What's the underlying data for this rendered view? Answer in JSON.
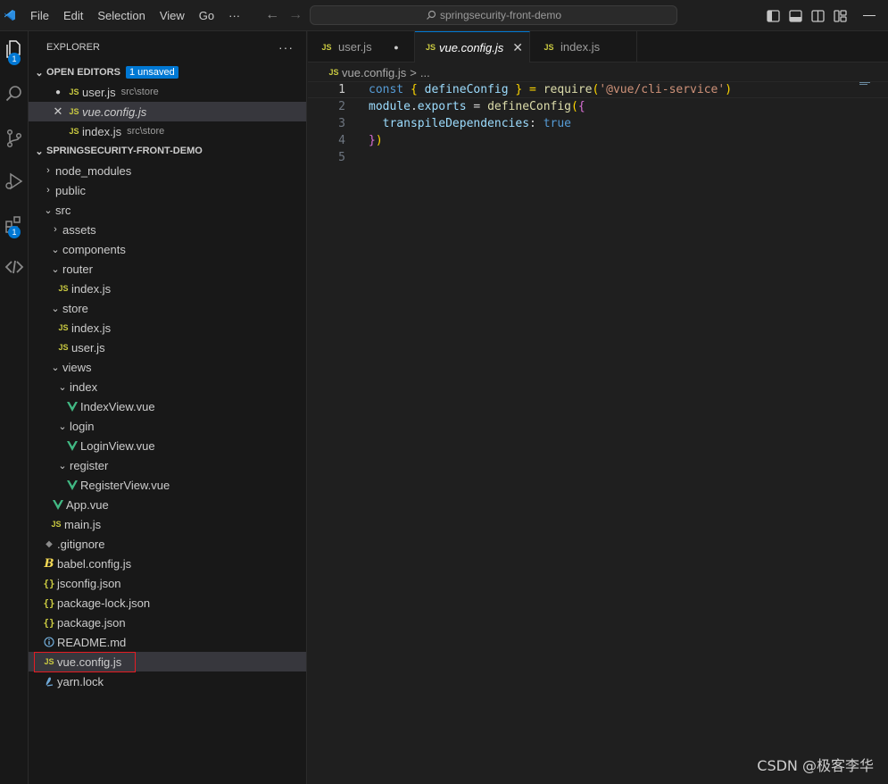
{
  "menu": [
    "File",
    "Edit",
    "Selection",
    "View",
    "Go",
    "···"
  ],
  "search": {
    "text": "springsecurity-front-demo"
  },
  "activity": {
    "explorer_badge": "1",
    "extensions_badge": "1"
  },
  "sidebar": {
    "title": "EXPLORER",
    "more": "···",
    "open_editors": {
      "label": "OPEN EDITORS",
      "badge": "1 unsaved",
      "items": [
        {
          "name": "user.js",
          "desc": "src\\store"
        },
        {
          "name": "vue.config.js",
          "desc": ""
        },
        {
          "name": "index.js",
          "desc": "src\\store"
        }
      ]
    },
    "project": {
      "label": "SPRINGSECURITY-FRONT-DEMO",
      "tree": [
        "node_modules",
        "public",
        "src",
        "assets",
        "components",
        "router",
        "index.js",
        "store",
        "index.js",
        "user.js",
        "views",
        "index",
        "IndexView.vue",
        "login",
        "LoginView.vue",
        "register",
        "RegisterView.vue",
        "App.vue",
        "main.js",
        ".gitignore",
        "babel.config.js",
        "jsconfig.json",
        "package-lock.json",
        "package.json",
        "README.md",
        "vue.config.js",
        "yarn.lock"
      ]
    }
  },
  "icons": {
    "js": "JS",
    "json": "{}",
    "gitignore": "◆",
    "babel": "B"
  },
  "tabs": [
    {
      "label": "user.js"
    },
    {
      "label": "vue.config.js"
    },
    {
      "label": "index.js"
    }
  ],
  "breadcrumb": {
    "file": "vue.config.js",
    "sep": ">",
    "rest": "..."
  },
  "code": {
    "line_numbers": [
      "1",
      "2",
      "3",
      "4",
      "5"
    ],
    "l1": {
      "kw": "const",
      "open": " { ",
      "name": "defineConfig",
      "close": " } = ",
      "fn": "require",
      "paren": "(",
      "str": "'@vue/cli-service'",
      "endparen": ")"
    },
    "l2": {
      "obj": "module",
      "dot": ".",
      "prop": "exports",
      "eq": " = ",
      "fn": "defineConfig",
      "p": "(",
      "b": "{"
    },
    "l3": {
      "indent": "  ",
      "key": "transpileDependencies",
      "colon": ": ",
      "val": "true"
    },
    "l4": {
      "b": "}",
      "p": ")"
    }
  },
  "watermark": "CSDN @极客李华",
  "colors": {
    "accent": "#0078d4",
    "highlight_border": "#e51c23",
    "js": "#cbcb41",
    "vue": "#41b883"
  }
}
